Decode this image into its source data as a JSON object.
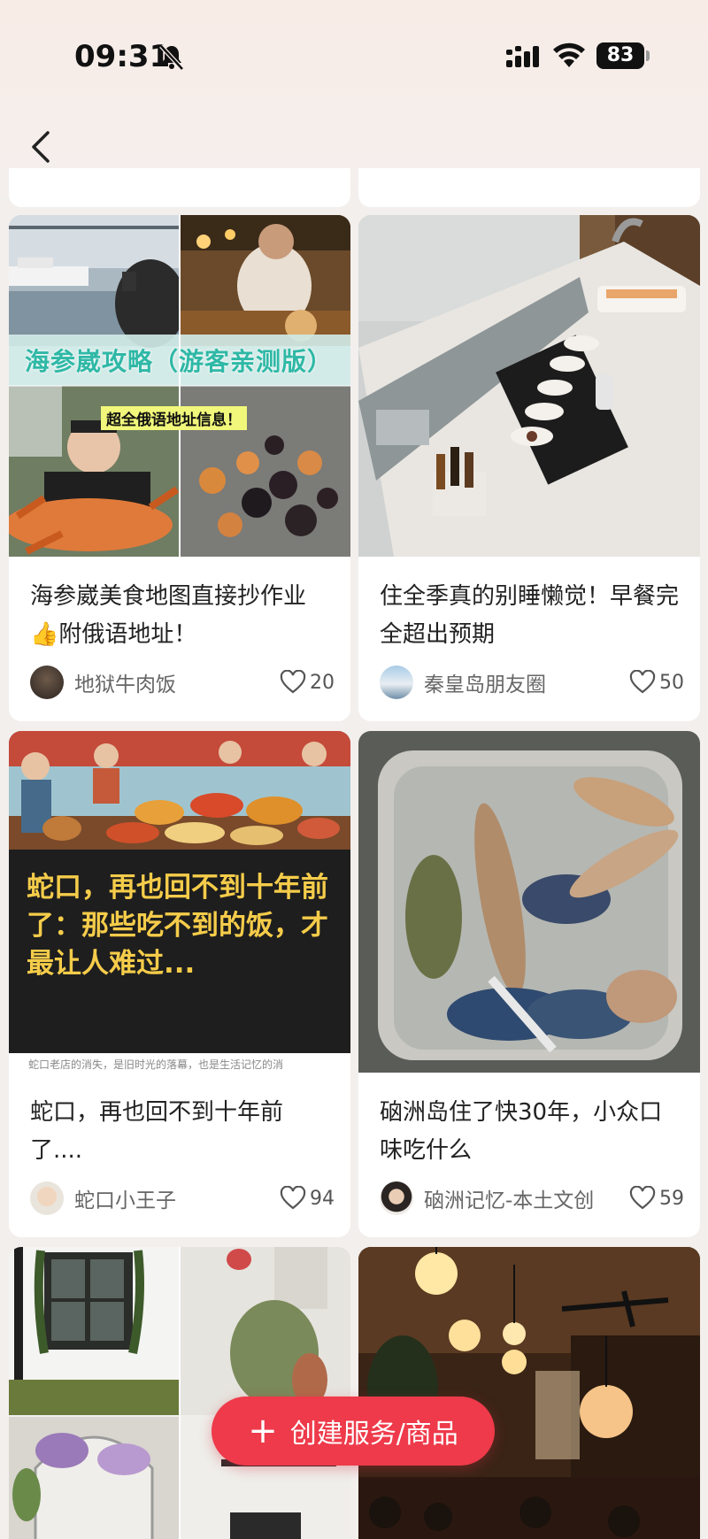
{
  "status_bar": {
    "time": "09:31",
    "battery": "83"
  },
  "feed": {
    "cards": [
      {
        "title": "海参崴美食地图直接抄作业👍附俄语地址！",
        "author": "地狱牛肉饭",
        "likes": "20",
        "cover_overlay": {
          "headline": "海参崴攻略（游客亲测版）",
          "subline": "超全俄语地址信息！"
        }
      },
      {
        "title": "住全季真的别睡懒觉！早餐完全超出预期",
        "author": "秦皇岛朋友圈",
        "likes": "50"
      },
      {
        "title": "蛇口，再也回不到十年前了....",
        "author": "蛇口小王子",
        "likes": "94",
        "cover_overlay": {
          "headline": "蛇口，再也回不到十年前了：那些吃不到的饭，才最让人难过...",
          "subline": "蛇口老店的消失，是旧时光的落幕，也是生活记忆的消"
        }
      },
      {
        "title": "硇洲岛住了快30年，小众口味吃什么",
        "author": "硇洲记忆-本土文创",
        "likes": "59"
      }
    ]
  },
  "fab": {
    "label": "创建服务/商品"
  },
  "icons": {
    "back": "chevron-left-icon",
    "like": "heart-outline-icon",
    "bell": "bell-muted-icon"
  },
  "colors": {
    "accent": "#ee3a4a",
    "background": "#f3efed"
  }
}
